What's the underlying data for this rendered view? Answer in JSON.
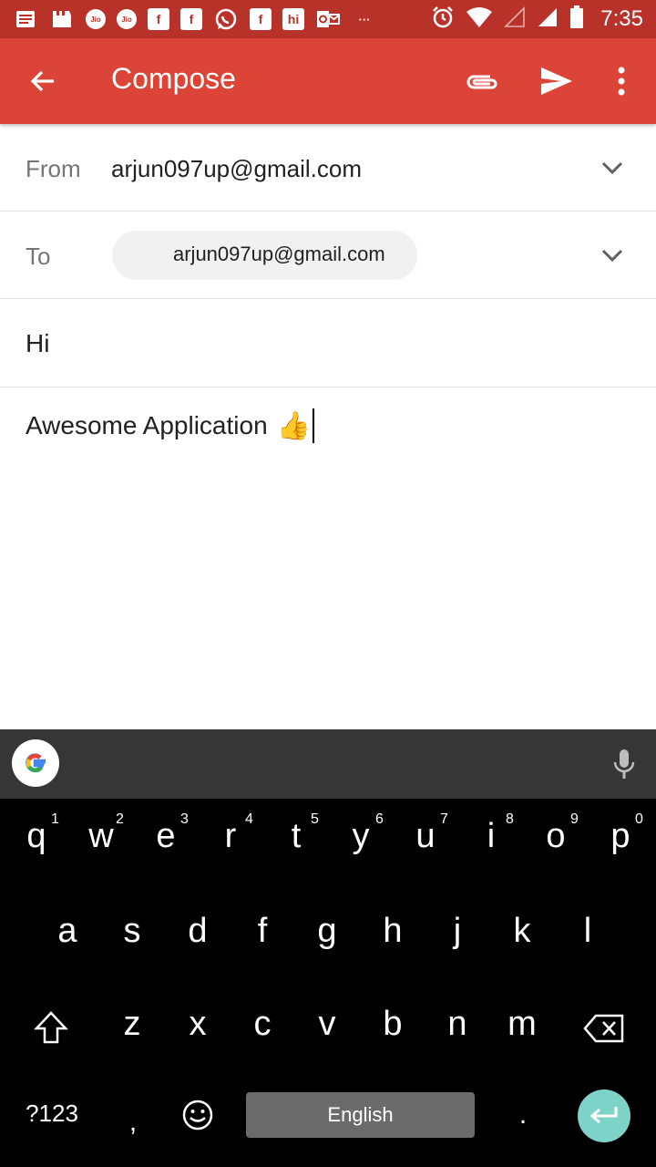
{
  "status_bar": {
    "time": "7:35",
    "left_icons": [
      "news-icon",
      "clapper-icon",
      "jio-icon",
      "jio-icon",
      "facebook-icon",
      "facebook-icon",
      "whatsapp-icon",
      "facebook-icon",
      "hike-icon",
      "outlook-icon",
      "more-dots-icon"
    ],
    "jio_label": "Jio",
    "hi_label": "hi",
    "more_label": "···"
  },
  "app_bar": {
    "title": "Compose",
    "color": "#db4437",
    "status_color": "#b9322a"
  },
  "from": {
    "label": "From",
    "value": "arjun097up@gmail.com"
  },
  "to": {
    "label": "To",
    "chip": "arjun097up@gmail.com"
  },
  "subject": "Hi",
  "body": {
    "text": "Awesome Application",
    "emoji": "👍"
  },
  "keyboard": {
    "row1": [
      {
        "k": "q",
        "h": "1"
      },
      {
        "k": "w",
        "h": "2"
      },
      {
        "k": "e",
        "h": "3"
      },
      {
        "k": "r",
        "h": "4"
      },
      {
        "k": "t",
        "h": "5"
      },
      {
        "k": "y",
        "h": "6"
      },
      {
        "k": "u",
        "h": "7"
      },
      {
        "k": "i",
        "h": "8"
      },
      {
        "k": "o",
        "h": "9"
      },
      {
        "k": "p",
        "h": "0"
      }
    ],
    "row2": [
      "a",
      "s",
      "d",
      "f",
      "g",
      "h",
      "j",
      "k",
      "l"
    ],
    "row3": [
      "z",
      "x",
      "c",
      "v",
      "b",
      "n",
      "m"
    ],
    "symbols_label": "?123",
    "comma": ",",
    "period": ".",
    "space_label": "English",
    "enter_color": "#7dd3c8"
  }
}
